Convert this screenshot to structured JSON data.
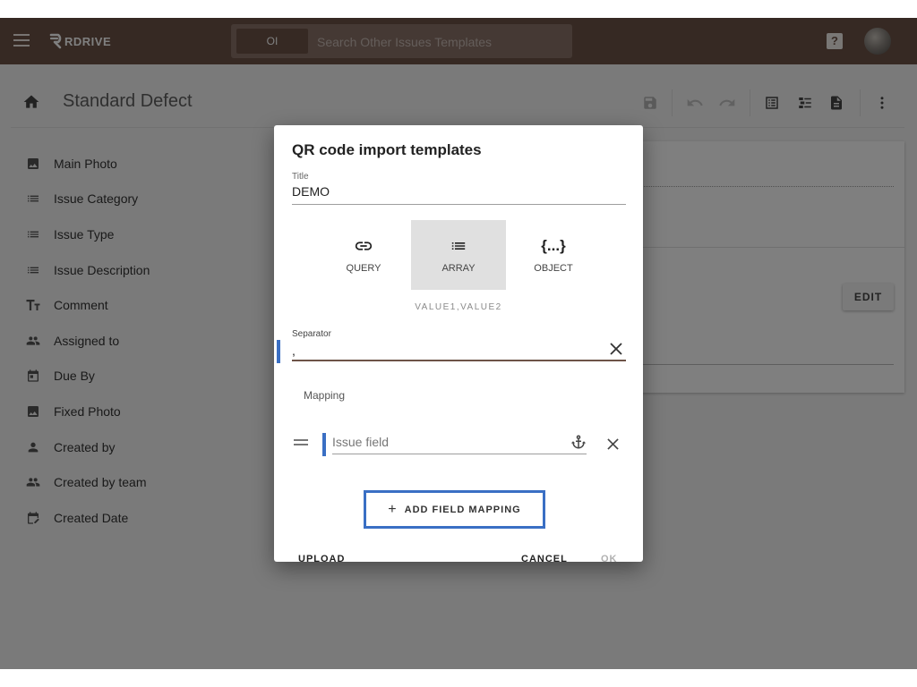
{
  "header": {
    "brand": "RDRIVE",
    "search_chip": "OI",
    "search_placeholder": "Search Other Issues Templates"
  },
  "page": {
    "title": "Standard Defect"
  },
  "sidebar": {
    "items": [
      {
        "label": "Main Photo",
        "icon": "image-icon"
      },
      {
        "label": "Issue Category",
        "icon": "list-icon"
      },
      {
        "label": "Issue Type",
        "icon": "list-icon"
      },
      {
        "label": "Issue Description",
        "icon": "list-icon"
      },
      {
        "label": "Comment",
        "icon": "text-format-icon"
      },
      {
        "label": "Assigned to",
        "icon": "people-icon"
      },
      {
        "label": "Due By",
        "icon": "calendar-icon"
      },
      {
        "label": "Fixed Photo",
        "icon": "image-icon"
      },
      {
        "label": "Created by",
        "icon": "person-icon"
      },
      {
        "label": "Created by team",
        "icon": "people-icon"
      },
      {
        "label": "Created Date",
        "icon": "calendar-edit-icon"
      }
    ]
  },
  "right_panel": {
    "edit_label": "EDIT"
  },
  "dialog": {
    "title": "QR code import templates",
    "title_field_label": "Title",
    "title_field_value": "DEMO",
    "modes": [
      {
        "label": "QUERY",
        "icon": "link-icon",
        "active": false
      },
      {
        "label": "ARRAY",
        "icon": "list-icon",
        "active": true
      },
      {
        "label": "OBJECT",
        "icon": "braces-icon",
        "active": false
      }
    ],
    "mode_hint": "VALUE1,VALUE2",
    "separator_label": "Separator",
    "separator_value": ",",
    "mapping_label": "Mapping",
    "mapping_field_placeholder": "Issue field",
    "add_mapping_label": "ADD FIELD MAPPING",
    "upload_label": "UPLOAD",
    "cancel_label": "CANCEL",
    "ok_label": "OK"
  },
  "colors": {
    "header_bg": "#6d5347",
    "focus_accent": "#3a6fc4"
  }
}
